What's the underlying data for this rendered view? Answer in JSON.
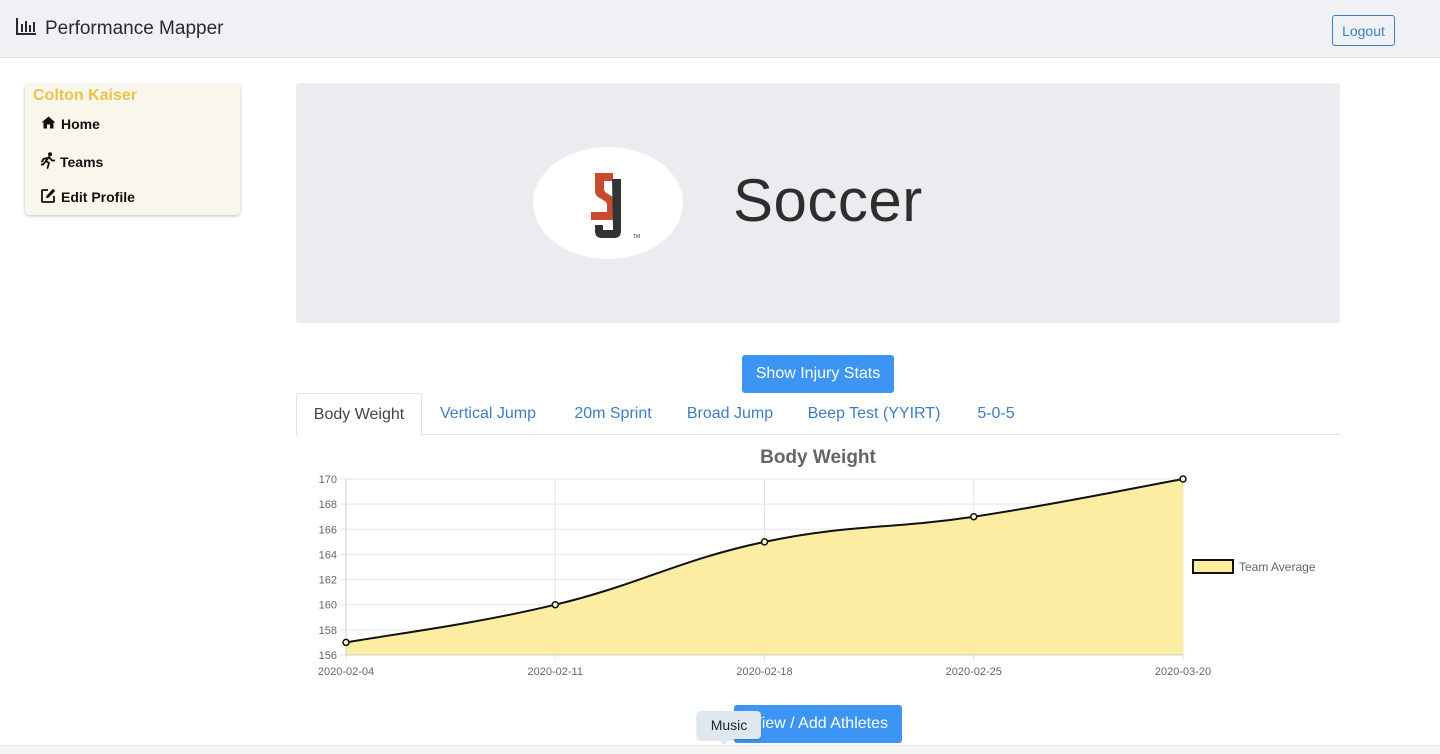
{
  "app": {
    "title": "Performance Mapper",
    "logout_label": "Logout"
  },
  "sidebar": {
    "user": "Colton Kaiser",
    "items": [
      {
        "label": "Home",
        "icon": "home-icon"
      },
      {
        "label": "Teams",
        "icon": "running-icon"
      },
      {
        "label": "Edit Profile",
        "icon": "edit-icon"
      }
    ]
  },
  "hero": {
    "team_name": "Soccer",
    "logo_icon": "su-logo",
    "logo_colors": {
      "primary": "#c84b2f",
      "secondary": "#333333"
    }
  },
  "buttons": {
    "injury_stats": "Show Injury Stats",
    "athletes": "View / Add Athletes"
  },
  "tabs": [
    {
      "label": "Body Weight",
      "active": true
    },
    {
      "label": "Vertical Jump",
      "active": false
    },
    {
      "label": "20m Sprint",
      "active": false
    },
    {
      "label": "Broad Jump",
      "active": false
    },
    {
      "label": "Beep Test (YYIRT)",
      "active": false
    },
    {
      "label": "5-0-5",
      "active": false
    }
  ],
  "tooltip": {
    "label": "Music"
  },
  "chart_data": {
    "type": "area",
    "title": "Body Weight",
    "categories": [
      "2020-02-04",
      "2020-02-11",
      "2020-02-18",
      "2020-02-25",
      "2020-03-20"
    ],
    "series": [
      {
        "name": "Team Average",
        "values": [
          157,
          160,
          165,
          167,
          170
        ]
      }
    ],
    "ylim": [
      156,
      170
    ],
    "yticks": [
      156,
      158,
      160,
      162,
      164,
      166,
      168,
      170
    ],
    "grid": true,
    "legend": "right",
    "colors": {
      "fill": "#fcec9e",
      "line": "#111111"
    }
  }
}
